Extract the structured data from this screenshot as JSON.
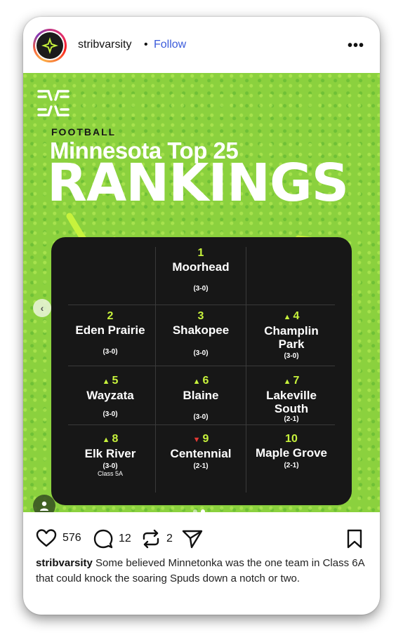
{
  "header": {
    "username": "stribvarsity",
    "separator": "•",
    "follow_label": "Follow",
    "more_label": "•••"
  },
  "post": {
    "section_label": "FOOTBALL",
    "title_line": "Minnesota Top 25",
    "title_big": "RANKINGS",
    "rankings": [
      {
        "rank": "1",
        "team": "Moorhead",
        "record": "(3-0)",
        "trend": ""
      },
      {
        "rank": "2",
        "team": "Eden Prairie",
        "record": "(3-0)",
        "trend": ""
      },
      {
        "rank": "3",
        "team": "Shakopee",
        "record": "(3-0)",
        "trend": ""
      },
      {
        "rank": "4",
        "team": "Champlin Park",
        "record": "(3-0)",
        "trend": "up"
      },
      {
        "rank": "5",
        "team": "Wayzata",
        "record": "(3-0)",
        "trend": "up"
      },
      {
        "rank": "6",
        "team": "Blaine",
        "record": "(3-0)",
        "trend": "up"
      },
      {
        "rank": "7",
        "team": "Lakeville South",
        "record": "(2-1)",
        "trend": "up"
      },
      {
        "rank": "8",
        "team": "Elk River",
        "record": "(3-0)",
        "trend": "up",
        "note": "Class 5A"
      },
      {
        "rank": "9",
        "team": "Centennial",
        "record": "(2-1)",
        "trend": "down"
      },
      {
        "rank": "10",
        "team": "Maple Grove",
        "record": "(2-1)",
        "trend": ""
      }
    ],
    "carousel": {
      "current": 2,
      "total": 2
    },
    "colors": {
      "background": "#8bd13e",
      "board": "#171717",
      "accent": "#c7f23c",
      "down": "#e53935"
    }
  },
  "actions": {
    "likes": "576",
    "comments": "12",
    "reposts": "2"
  },
  "caption": {
    "username": "stribvarsity",
    "text": "Some believed Minnetonka was the one team in Class 6A that could knock the soaring Spuds down a notch or two."
  },
  "icons": [
    "heart-icon",
    "comment-icon",
    "repost-icon",
    "share-icon",
    "bookmark-icon",
    "more-icon",
    "chevron-left-icon",
    "user-tag-icon"
  ]
}
